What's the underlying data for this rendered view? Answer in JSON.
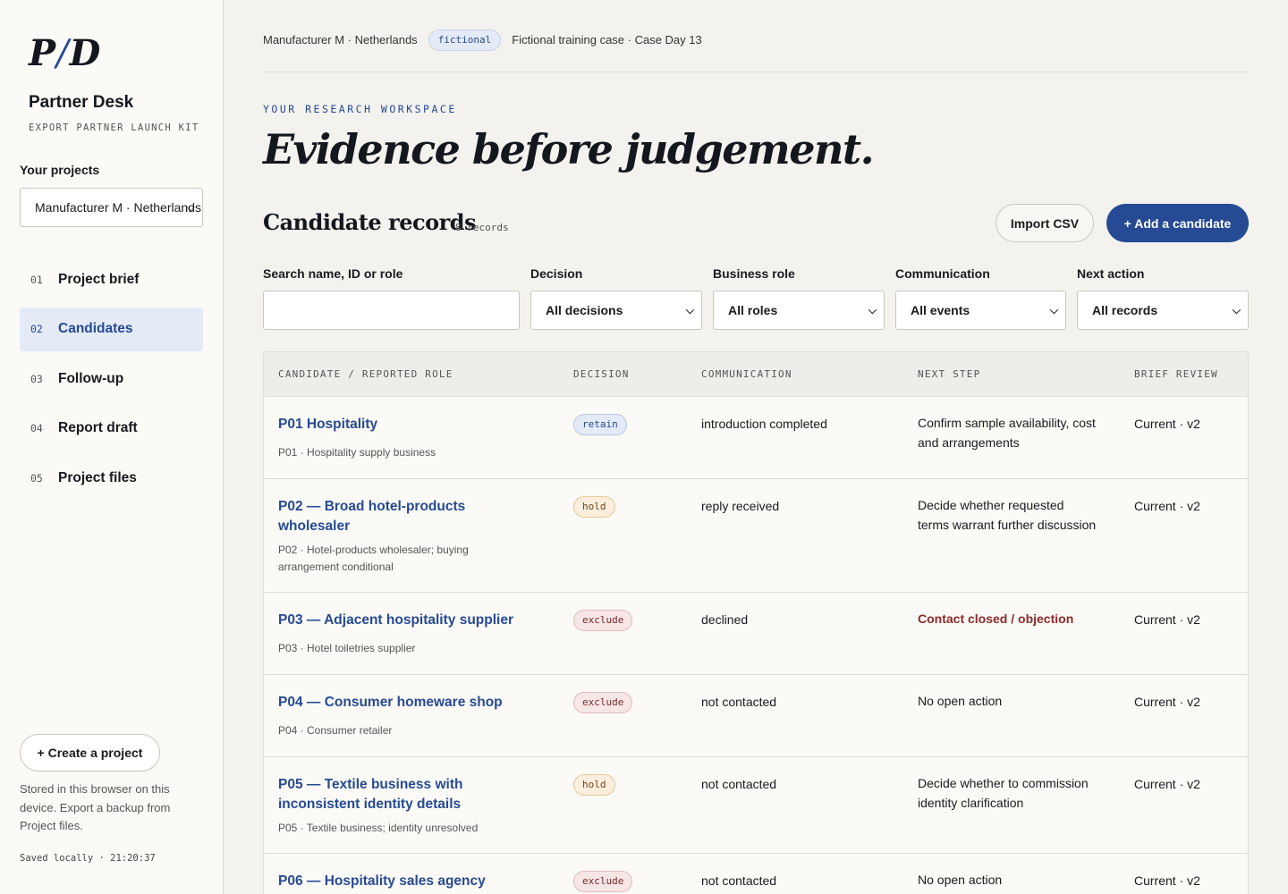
{
  "sidebar": {
    "logo_left": "P",
    "logo_slash": "/",
    "logo_right": "D",
    "brand_title": "Partner Desk",
    "brand_subtitle": "EXPORT PARTNER LAUNCH KIT",
    "projects_label": "Your projects",
    "project_select_value": "Manufacturer M · Netherlands",
    "nav": [
      {
        "num": "01",
        "label": "Project brief",
        "active": false
      },
      {
        "num": "02",
        "label": "Candidates",
        "active": true
      },
      {
        "num": "03",
        "label": "Follow-up",
        "active": false
      },
      {
        "num": "04",
        "label": "Report draft",
        "active": false
      },
      {
        "num": "05",
        "label": "Project files",
        "active": false
      }
    ],
    "create_button": "+ Create a project",
    "storage_note": "Stored in this browser on this device. Export a backup from Project files.",
    "saved_status": "Saved locally · 21:20:37"
  },
  "topbar": {
    "context": "Manufacturer M · Netherlands",
    "badge": "fictional",
    "case_info": "Fictional training case · Case Day 13"
  },
  "main": {
    "eyebrow": "YOUR RESEARCH WORKSPACE",
    "headline": "Evidence before judgement.",
    "section_title": "Candidate records",
    "record_count": "8 records",
    "import_button": "Import CSV",
    "add_button": "+ Add a candidate"
  },
  "filters": {
    "search": {
      "label": "Search name, ID or role",
      "value": ""
    },
    "decision": {
      "label": "Decision",
      "value": "All decisions"
    },
    "role": {
      "label": "Business role",
      "value": "All roles"
    },
    "communication": {
      "label": "Communication",
      "value": "All events"
    },
    "next_action": {
      "label": "Next action",
      "value": "All records"
    }
  },
  "table": {
    "headers": [
      "CANDIDATE / REPORTED ROLE",
      "DECISION",
      "COMMUNICATION",
      "NEXT STEP",
      "BRIEF REVIEW"
    ],
    "rows": [
      {
        "title": "P01 Hospitality",
        "subtitle": "P01 · Hospitality supply business",
        "decision": "retain",
        "communication": "introduction completed",
        "next_step": "Confirm sample availability, cost and arrangements",
        "next_alert": false,
        "brief": "Current · v2"
      },
      {
        "title": "P02 — Broad hotel-products wholesaler",
        "subtitle": "P02 · Hotel-products wholesaler; buying arrangement conditional",
        "decision": "hold",
        "communication": "reply received",
        "next_step": "Decide whether requested terms warrant further discussion",
        "next_alert": false,
        "brief": "Current · v2"
      },
      {
        "title": "P03 — Adjacent hospitality supplier",
        "subtitle": "P03 · Hotel toiletries supplier",
        "decision": "exclude",
        "communication": "declined",
        "next_step": "Contact closed / objection",
        "next_alert": true,
        "brief": "Current · v2"
      },
      {
        "title": "P04 — Consumer homeware shop",
        "subtitle": "P04 · Consumer retailer",
        "decision": "exclude",
        "communication": "not contacted",
        "next_step": "No open action",
        "next_alert": false,
        "brief": "Current · v2"
      },
      {
        "title": "P05 — Textile business with inconsistent identity details",
        "subtitle": "P05 · Textile business; identity unresolved",
        "decision": "hold",
        "communication": "not contacted",
        "next_step": "Decide whether to commission identity clarification",
        "next_alert": false,
        "brief": "Current · v2"
      },
      {
        "title": "P06 — Hospitality sales agency",
        "subtitle": "",
        "decision": "exclude",
        "communication": "not contacted",
        "next_step": "No open action",
        "next_alert": false,
        "brief": "Current · v2"
      }
    ]
  },
  "colors": {
    "accent": "#264a93",
    "alert": "#8a2a2a",
    "background": "#f3f2ee",
    "sidebar_bg": "#fbfaf6"
  },
  "icons": {
    "select_chevron": "chevron-down-icon"
  }
}
